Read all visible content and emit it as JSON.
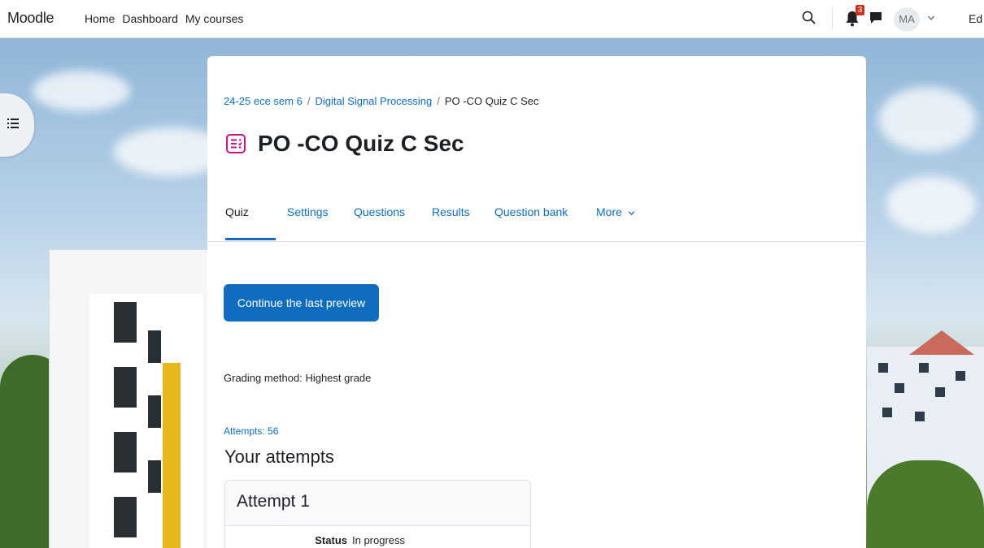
{
  "navbar": {
    "brand": "Moodle",
    "links": [
      "Home",
      "Dashboard",
      "My courses"
    ],
    "notification_count": "3",
    "user_initials": "MA",
    "edit_mode_label": "Ed",
    "icons": [
      "search-icon",
      "bell-icon",
      "chat-icon",
      "chevron-down-icon"
    ]
  },
  "breadcrumb": {
    "items": [
      "24-25 ece sem 6",
      "Digital Signal Processing",
      "PO -CO Quiz C Sec"
    ],
    "separator": "/"
  },
  "page": {
    "title": "PO -CO Quiz C Sec",
    "icon": "quiz-icon",
    "icon_color": "#c6138d"
  },
  "tabs": {
    "items": [
      "Quiz",
      "Settings",
      "Questions",
      "Results",
      "Question bank",
      "More"
    ],
    "active": "Quiz"
  },
  "main": {
    "continue_button": "Continue the last preview",
    "grading_method": "Grading method: Highest grade",
    "attempts_link": "Attempts: 56",
    "your_attempts_heading": "Your attempts",
    "attempt_title": "Attempt 1",
    "status_label": "Status",
    "status_value": "In progress"
  },
  "colors": {
    "primary": "#0f6cbf",
    "badge": "#ca3120",
    "text": "#1d2125"
  }
}
